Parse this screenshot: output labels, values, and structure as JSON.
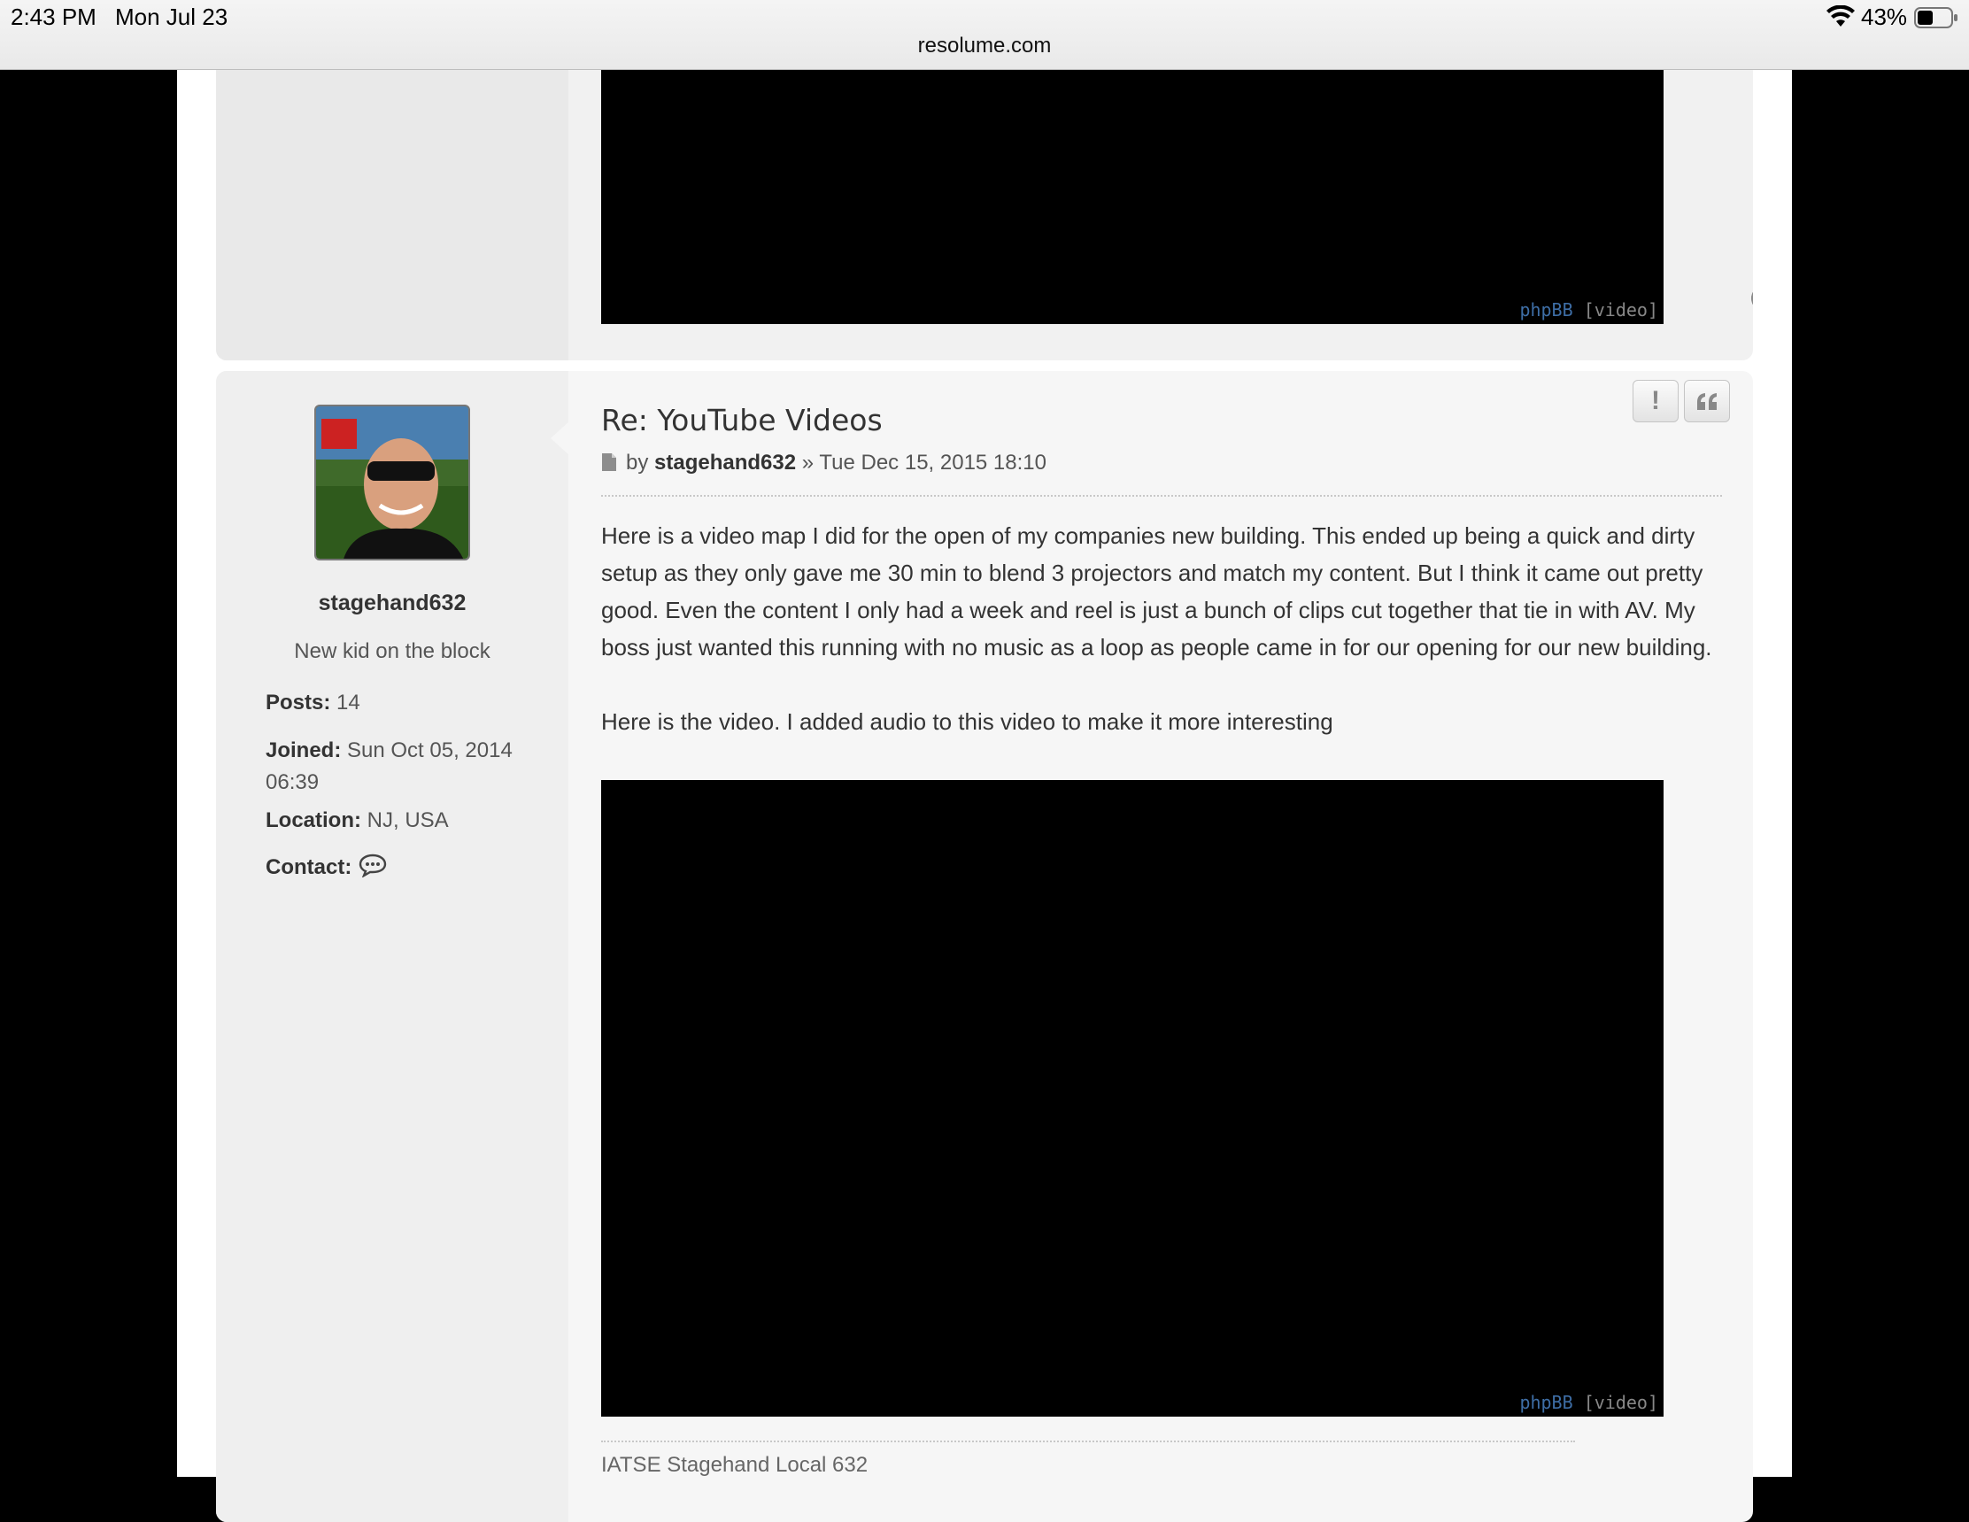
{
  "status_bar": {
    "time": "2:43 PM",
    "date": "Mon Jul 23",
    "url": "resolume.com",
    "battery": "43%"
  },
  "previous_post": {
    "video": {
      "brand": "phpBB",
      "tag": "[video]"
    }
  },
  "post": {
    "title": "Re: YouTube Videos",
    "meta_by": "by",
    "meta_author": "stagehand632",
    "meta_date": "» Tue Dec 15, 2015 18:10",
    "body": [
      "Here is a video map I did for the open of my companies new building. This ended up being a quick and dirty setup as they only gave me 30 min to blend 3 projectors and match my content. But I think it came out pretty good. Even the content I only had a week and reel is just a bunch of clips cut together that tie in with AV. My boss just wanted this running with no music as a loop as people came in for our opening for our new building.",
      "Here is the video. I added audio to this video to make it more interesting"
    ],
    "video": {
      "brand": "phpBB",
      "tag": "[video]"
    },
    "signature": "IATSE Stagehand Local 632",
    "buttons": {
      "report": "!",
      "quote": "quote-icon"
    }
  },
  "profile": {
    "username": "stagehand632",
    "rank": "New kid on the block",
    "posts_label": "Posts:",
    "posts_value": "14",
    "joined_label": "Joined:",
    "joined_value": "Sun Oct 05, 2014 06:39",
    "location_label": "Location:",
    "location_value": "NJ, USA",
    "contact_label": "Contact:"
  },
  "colors": {
    "link_blue": "#3e6ea6",
    "post_bg": "#f6f6f6",
    "profile_bg": "#efefef"
  }
}
